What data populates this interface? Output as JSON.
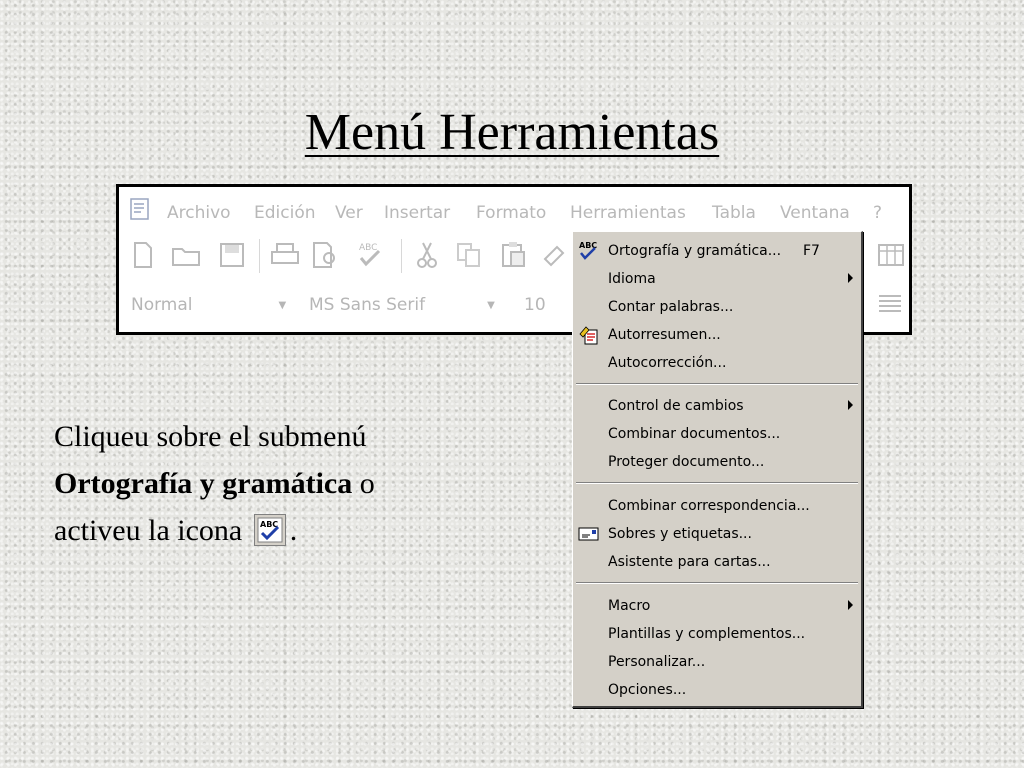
{
  "slide": {
    "title": "Menú Herramientas",
    "text_line1": "Cliqueu sobre el submenú",
    "text_bold": "Ortografía y gramática",
    "text_after_bold": "o",
    "text_line3": "activeu la icona",
    "text_end": "."
  },
  "word_window": {
    "menu_bar": [
      {
        "label": "Archivo"
      },
      {
        "label": "Edición"
      },
      {
        "label": "Ver"
      },
      {
        "label": "Insertar"
      },
      {
        "label": "Formato"
      },
      {
        "label": "Herramientas"
      },
      {
        "label": "Tabla"
      },
      {
        "label": "Ventana"
      },
      {
        "label": "?"
      }
    ],
    "style_combo": "Normal",
    "font_combo": "MS Sans Serif",
    "size_combo": "10"
  },
  "tools_menu": {
    "items": [
      {
        "label": "Ortografía y gramática...",
        "shortcut": "F7",
        "icon": "spelling-check-icon"
      },
      {
        "label": "Idioma",
        "submenu": true
      },
      {
        "label": "Contar palabras..."
      },
      {
        "label": "Autorresumen...",
        "icon": "autosummarize-icon"
      },
      {
        "label": "Autocorrección..."
      },
      {
        "label": "Control de cambios",
        "submenu": true
      },
      {
        "label": "Combinar documentos..."
      },
      {
        "label": "Proteger documento..."
      },
      {
        "label": "Combinar correspondencia..."
      },
      {
        "label": "Sobres y etiquetas...",
        "icon": "envelope-icon"
      },
      {
        "label": "Asistente para cartas..."
      },
      {
        "label": "Macro",
        "submenu": true
      },
      {
        "label": "Plantillas y complementos..."
      },
      {
        "label": "Personalizar..."
      },
      {
        "label": "Opciones..."
      }
    ]
  },
  "colors": {
    "menu_bg": "#d4d0c8",
    "disabled_text": "#b8b8b8",
    "check_blue": "#1f3fa8"
  }
}
